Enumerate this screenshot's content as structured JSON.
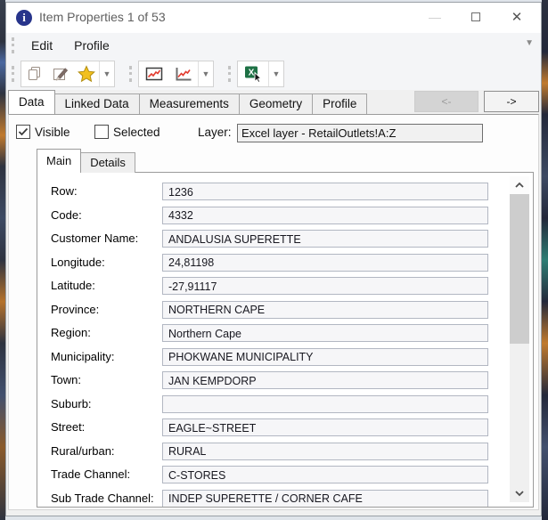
{
  "window": {
    "title": "Item Properties 1 of 53",
    "minimize_glyph": "—",
    "close_glyph": "✕"
  },
  "menu": {
    "items": [
      {
        "label": "Edit"
      },
      {
        "label": "Profile"
      }
    ],
    "overflow_glyph": "▼"
  },
  "toolbar": {
    "dropdown_glyph": "▼",
    "groups": [
      {
        "name": "clipboard",
        "icons": [
          "copy-icon",
          "edit-item-icon",
          "favorite-star-icon"
        ]
      },
      {
        "name": "charts",
        "icons": [
          "chart-line-boxed-icon",
          "chart-line-axis-icon"
        ]
      },
      {
        "name": "excel",
        "icons": [
          "excel-select-icon"
        ]
      }
    ]
  },
  "tabs": {
    "items": [
      "Data",
      "Linked Data",
      "Measurements",
      "Geometry",
      "Profile"
    ],
    "active_index": 0
  },
  "nav_buttons": {
    "back_label": "<-",
    "forward_label": "->",
    "back_enabled": false
  },
  "data_tab": {
    "visible_label": "Visible",
    "visible_checked": true,
    "selected_label": "Selected",
    "selected_checked": false,
    "layer_label": "Layer:",
    "layer_value": "Excel layer - RetailOutlets!A:Z"
  },
  "subtabs": {
    "items": [
      "Main",
      "Details"
    ],
    "active_index": 0
  },
  "form": {
    "fields": [
      {
        "label": "Row:",
        "value": "1236"
      },
      {
        "label": "Code:",
        "value": "4332"
      },
      {
        "label": "Customer Name:",
        "value": "ANDALUSIA SUPERETTE"
      },
      {
        "label": "Longitude:",
        "value": "24,81198"
      },
      {
        "label": "Latitude:",
        "value": "-27,91117"
      },
      {
        "label": "Province:",
        "value": "NORTHERN CAPE"
      },
      {
        "label": "Region:",
        "value": "Northern Cape"
      },
      {
        "label": "Municipality:",
        "value": "PHOKWANE MUNICIPALITY"
      },
      {
        "label": "Town:",
        "value": "JAN KEMPDORP"
      },
      {
        "label": "Suburb:",
        "value": ""
      },
      {
        "label": "Street:",
        "value": "EAGLE~STREET"
      },
      {
        "label": "Rural/urban:",
        "value": "RURAL"
      },
      {
        "label": "Trade Channel:",
        "value": "C-STORES"
      },
      {
        "label": "Sub Trade Channel:",
        "value": "INDEP SUPERETTE / CORNER CAFE"
      }
    ]
  },
  "colors": {
    "accent_star": "#f2c01e",
    "chart_line": "#e23a2e",
    "excel_green": "#1e7145",
    "info_icon_blue": "#27348b"
  }
}
